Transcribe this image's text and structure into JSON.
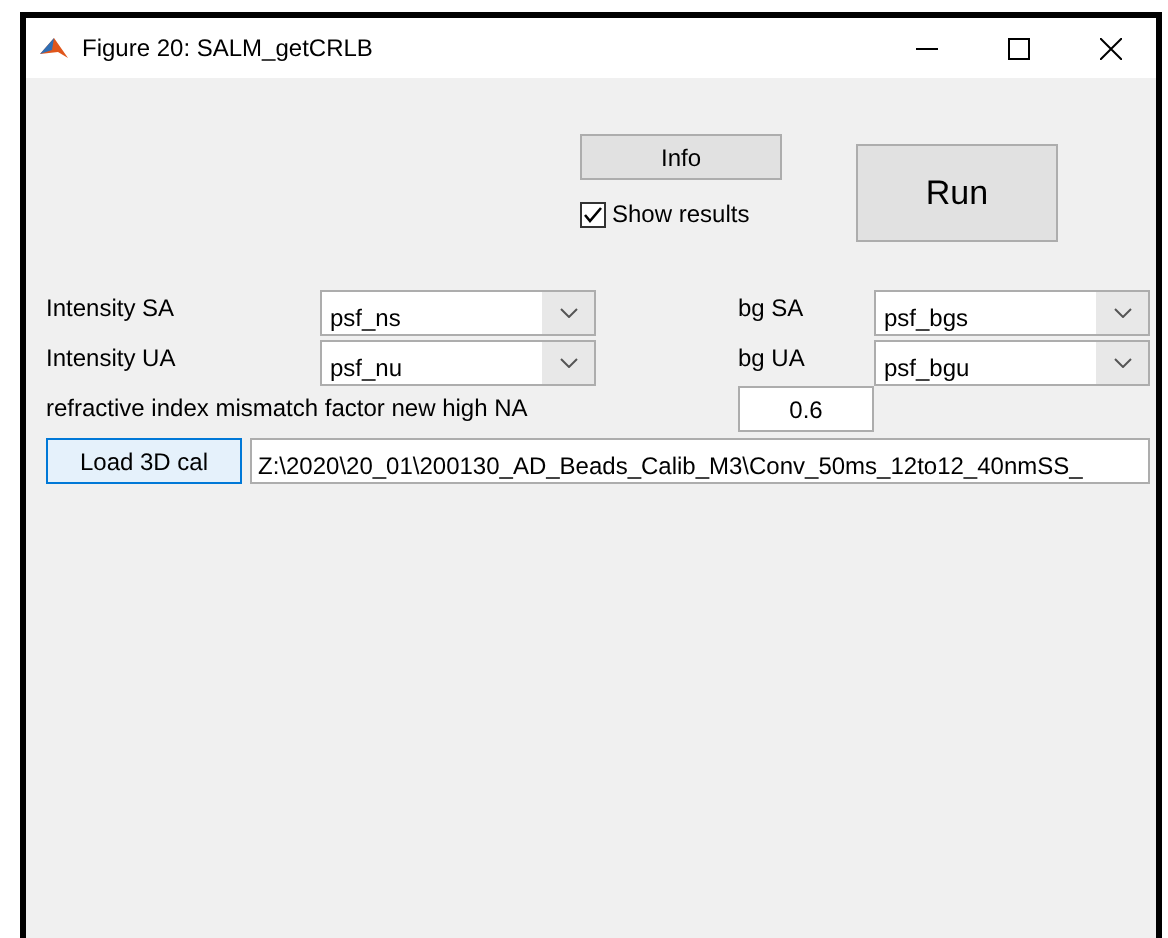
{
  "window": {
    "title": "Figure 20: SALM_getCRLB"
  },
  "info_button": "Info",
  "show_results": {
    "label": "Show results",
    "checked": true
  },
  "run_button": "Run",
  "selectors": [
    {
      "label": "Intensity SA",
      "value": "psf_ns",
      "label2": "bg SA",
      "value2": "psf_bgs"
    },
    {
      "label": "Intensity UA",
      "value": "psf_nu",
      "label2": "bg UA",
      "value2": "psf_bgu"
    }
  ],
  "mismatch": {
    "label": "refractive index mismatch factor new high NA",
    "value": "0.6"
  },
  "load_button": "Load 3D cal",
  "path": "Z:\\2020\\20_01\\200130_AD_Beads_Calib_M3\\Conv_50ms_12to12_40nmSS_"
}
